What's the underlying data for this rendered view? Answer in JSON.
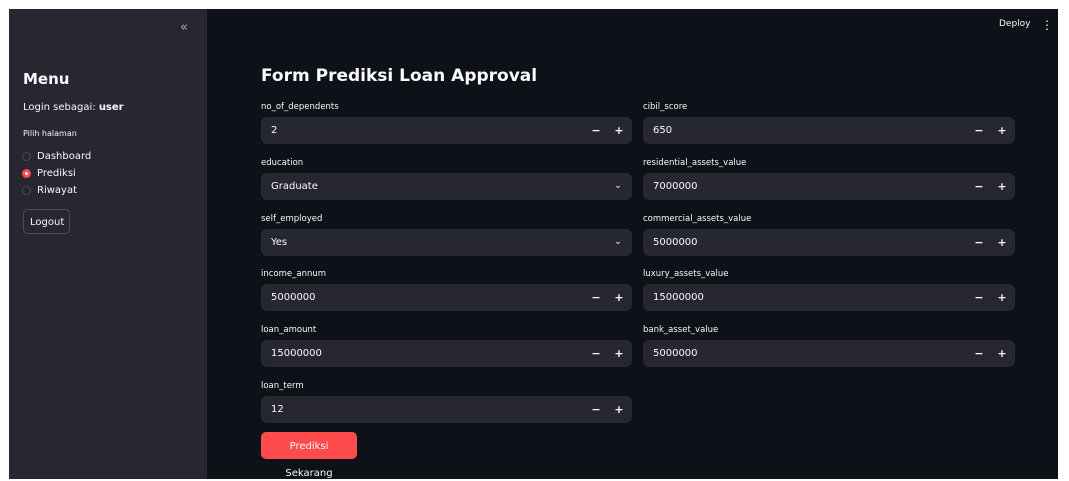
{
  "sidebar": {
    "collapse_glyph": "«",
    "menu_title": "Menu",
    "login_prefix": "Login sebagai:",
    "login_user": "user",
    "page_label": "Pilih halaman",
    "pages": [
      {
        "label": "Dashboard",
        "selected": false
      },
      {
        "label": "Prediksi",
        "selected": true
      },
      {
        "label": "Riwayat",
        "selected": false
      }
    ],
    "logout_label": "Logout"
  },
  "header": {
    "deploy_label": "Deploy",
    "menu_glyph": "⋮"
  },
  "form": {
    "title": "Form Prediksi Loan Approval",
    "left_fields": [
      {
        "label": "no_of_dependents",
        "value": "2",
        "kind": "number"
      },
      {
        "label": "education",
        "value": "Graduate",
        "kind": "select"
      },
      {
        "label": "self_employed",
        "value": "Yes",
        "kind": "select"
      },
      {
        "label": "income_annum",
        "value": "5000000",
        "kind": "number"
      },
      {
        "label": "loan_amount",
        "value": "15000000",
        "kind": "number"
      },
      {
        "label": "loan_term",
        "value": "12",
        "kind": "number"
      }
    ],
    "right_fields": [
      {
        "label": "cibil_score",
        "value": "650",
        "kind": "number"
      },
      {
        "label": "residential_assets_value",
        "value": "7000000",
        "kind": "number"
      },
      {
        "label": "commercial_assets_value",
        "value": "5000000",
        "kind": "number"
      },
      {
        "label": "luxury_assets_value",
        "value": "15000000",
        "kind": "number"
      },
      {
        "label": "bank_asset_value",
        "value": "5000000",
        "kind": "number"
      }
    ],
    "stepper_minus": "−",
    "stepper_plus": "+",
    "select_chevron": "⌄",
    "submit_label": "Prediksi Sekarang"
  },
  "colors": {
    "background": "#0e1117",
    "sidebar": "#262730",
    "input": "#262730",
    "accent": "#ff4b4b"
  }
}
